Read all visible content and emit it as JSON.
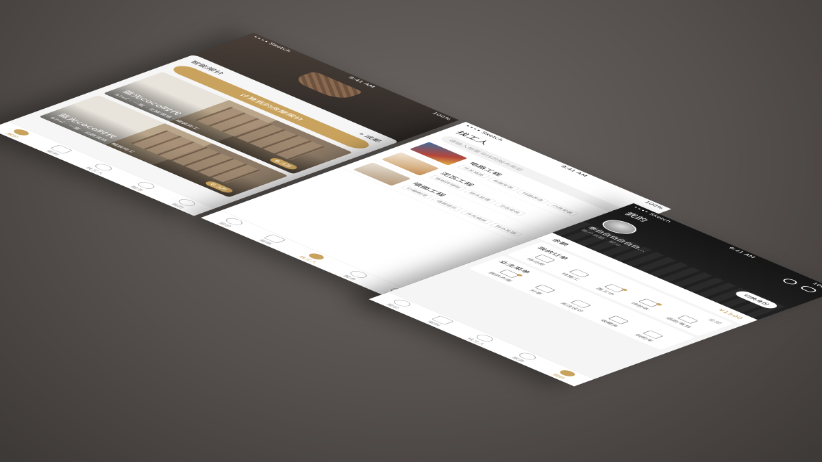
{
  "tabs": [
    "报价",
    "案例",
    "找工人",
    "服务",
    "我的"
  ],
  "colors": {
    "accent": "#c9a25d",
    "dark": "#1c1c1c",
    "bg": "#55504d"
  },
  "home": {
    "status": {
      "carrier": "•••• Sketch",
      "time": "9:41 AM",
      "battery": "100%"
    },
    "section_title": "智能报价",
    "city": "成都",
    "quote_button": "计算我的房屋报价",
    "cases": [
      {
        "title": "蓝光coco时代",
        "sub": "97㎡ · 一室 · 北欧混搭 · 精装完工",
        "price": "6.3万"
      },
      {
        "title": "蓝光coco时代",
        "sub": "97㎡ · 一室 · 北欧混搭 · 精装完工",
        "price": "6.3万"
      }
    ]
  },
  "workers": {
    "status": {
      "carrier": "•••• Sketch",
      "time": "9:41 AM",
      "battery": "100%"
    },
    "title": "找工人",
    "search_placeholder": "请输入想要寻找的服务类型",
    "city": "成都",
    "items": [
      {
        "title": "电路工程",
        "tags": [
          "开关插座",
          "电器安装",
          "线路改造",
          "灯具安装"
        ]
      },
      {
        "title": "泥瓦工程",
        "tags": [
          "墙地砖铺贴",
          "防水处理",
          "卫浴安装"
        ]
      },
      {
        "title": "墙面工程",
        "tags": [
          "打磨刷漆",
          "墙面修补",
          "开关插座",
          "防水处理"
        ]
      }
    ]
  },
  "mine": {
    "status": {
      "carrier": "•••• Sketch",
      "time": "9:41 AM",
      "battery": "100%"
    },
    "title": "我的",
    "name": "李白白白白白白...",
    "sub": "账户余额 · 积分",
    "switch_button": "切换身份",
    "balance_label": "余额",
    "balance_amount": "¥1500",
    "orders_title": "我的订单",
    "orders_more": "全部",
    "orders": [
      "待付款",
      "待施工",
      "施工中",
      "待验收",
      "退款/售后"
    ],
    "menu_title": "业主菜单",
    "menu": [
      "我的方案",
      "分享",
      "关注设计",
      "收藏夹",
      "购物车"
    ]
  }
}
